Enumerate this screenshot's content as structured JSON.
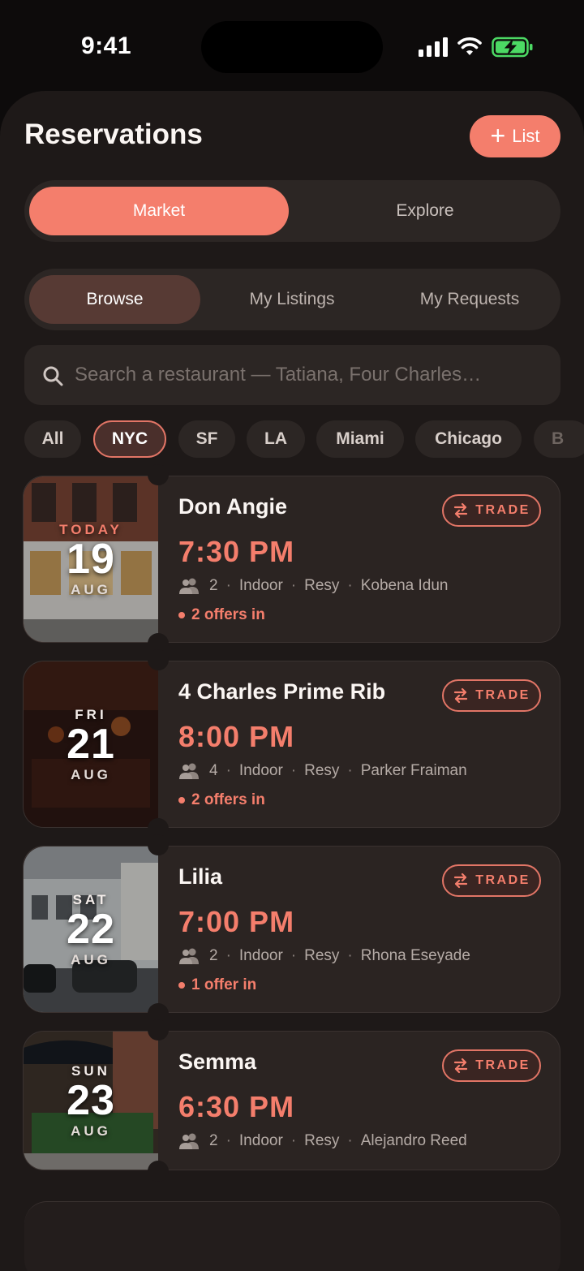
{
  "status": {
    "time": "9:41"
  },
  "header": {
    "title": "Reservations",
    "list_label": "List"
  },
  "mode_tabs": [
    {
      "label": "Market",
      "active": true
    },
    {
      "label": "Explore",
      "active": false
    }
  ],
  "sub_tabs": [
    {
      "label": "Browse",
      "active": true
    },
    {
      "label": "My Listings",
      "active": false
    },
    {
      "label": "My Requests",
      "active": false
    }
  ],
  "search": {
    "placeholder": "Search a restaurant — Tatiana, Four Charles…"
  },
  "cities": [
    {
      "label": "All"
    },
    {
      "label": "NYC",
      "active": true
    },
    {
      "label": "SF"
    },
    {
      "label": "LA"
    },
    {
      "label": "Miami"
    },
    {
      "label": "Chicago"
    },
    {
      "label": "B"
    }
  ],
  "listings": [
    {
      "dow": "TODAY",
      "day": "19",
      "month": "AUG",
      "name": "Don Angie",
      "time": "7:30 PM",
      "party": "2",
      "seating": "Indoor",
      "platform": "Resy",
      "host": "Kobena Idun",
      "offers": "2 offers in",
      "badge": "TRADE"
    },
    {
      "dow": "FRI",
      "day": "21",
      "month": "AUG",
      "name": "4 Charles Prime Rib",
      "time": "8:00 PM",
      "party": "4",
      "seating": "Indoor",
      "platform": "Resy",
      "host": "Parker Fraiman",
      "offers": "2 offers in",
      "badge": "TRADE"
    },
    {
      "dow": "SAT",
      "day": "22",
      "month": "AUG",
      "name": "Lilia",
      "time": "7:00 PM",
      "party": "2",
      "seating": "Indoor",
      "platform": "Resy",
      "host": "Rhona Eseyade",
      "offers": "1 offer in",
      "badge": "TRADE"
    },
    {
      "dow": "SUN",
      "day": "23",
      "month": "AUG",
      "name": "Semma",
      "time": "6:30 PM",
      "party": "2",
      "seating": "Indoor",
      "platform": "Resy",
      "host": "Alejandro Reed",
      "offers": "",
      "badge": "TRADE"
    }
  ],
  "colors": {
    "accent": "#f47e6c",
    "sheet": "#1e1918",
    "card": "#2b2422"
  }
}
